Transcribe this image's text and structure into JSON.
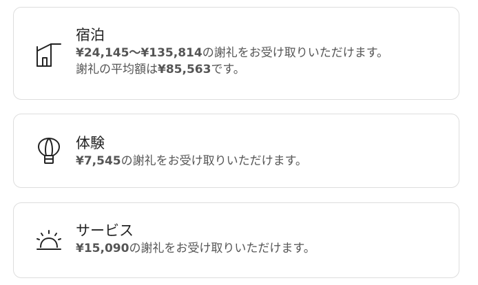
{
  "stays": {
    "title": "宿泊",
    "line1_amount": "¥24,145〜¥135,814",
    "line1_text": "の謝礼をお受け取りいただけます。",
    "line2_prefix": "謝礼の平均額は",
    "line2_amount": "¥85,563",
    "line2_suffix": "です。",
    "icon": "house-icon"
  },
  "experiences": {
    "title": "体験",
    "amount": "¥7,545",
    "text": "の謝礼をお受け取りいただけます。",
    "icon": "hot-air-balloon-icon"
  },
  "services": {
    "title": "サービス",
    "amount": "¥15,090",
    "text": "の謝礼をお受け取りいただけます。",
    "icon": "service-bell-icon"
  }
}
